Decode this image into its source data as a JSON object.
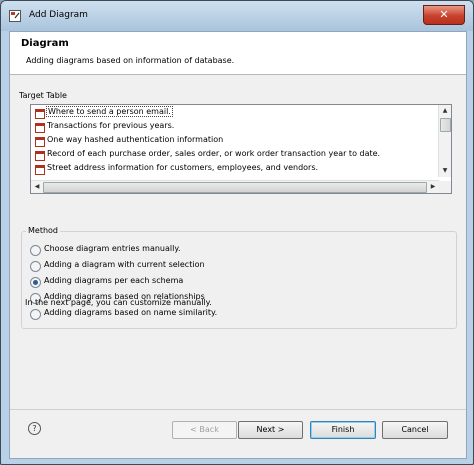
{
  "window": {
    "title": "Add Diagram",
    "close_label": "✕"
  },
  "header": {
    "title": "Diagram",
    "description": "Adding diagrams based on information of database."
  },
  "target_table": {
    "label": "Target Table",
    "rows": [
      "Where to send a person email.",
      "Transactions for previous years.",
      "One way hashed authentication information",
      "Record of each purchase order, sales order, or work order transaction year to date.",
      "Street address information for customers, employees, and vendors."
    ],
    "selected_index": 0
  },
  "method": {
    "label": "Method",
    "options": [
      "Choose diagram entries manually.",
      "Adding a diagram with current selection",
      "Adding diagrams per each schema",
      "Adding diagrams based on relationships",
      "Adding diagrams based on name similarity."
    ],
    "selected_index": 2
  },
  "hint": "In the next page, you can customize manually.",
  "footer": {
    "help_icon": "?",
    "back_label": "< Back",
    "next_label": "Next >",
    "finish_label": "Finish",
    "cancel_label": "Cancel"
  }
}
